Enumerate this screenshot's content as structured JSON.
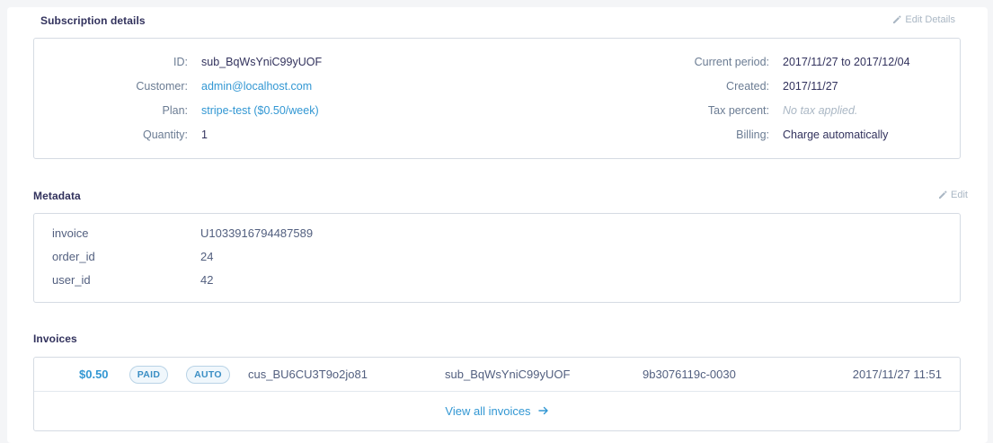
{
  "subscription": {
    "title": "Subscription details",
    "edit_label": "Edit Details",
    "left": [
      {
        "label": "ID:",
        "value": "sub_BqWsYniC99yUOF",
        "style": "plain"
      },
      {
        "label": "Customer:",
        "value": "admin@localhost.com",
        "style": "link"
      },
      {
        "label": "Plan:",
        "value": "stripe-test ($0.50/week)",
        "style": "link"
      },
      {
        "label": "Quantity:",
        "value": "1",
        "style": "plain"
      }
    ],
    "right": [
      {
        "label": "Current period:",
        "value": "2017/11/27 to 2017/12/04",
        "style": "plain"
      },
      {
        "label": "Created:",
        "value": "2017/11/27",
        "style": "plain"
      },
      {
        "label": "Tax percent:",
        "value": "No tax applied.",
        "style": "muted"
      },
      {
        "label": "Billing:",
        "value": "Charge automatically",
        "style": "plain"
      }
    ]
  },
  "metadata": {
    "title": "Metadata",
    "edit_label": "Edit",
    "rows": [
      {
        "key": "invoice",
        "value": "U1033916794487589"
      },
      {
        "key": "order_id",
        "value": "24"
      },
      {
        "key": "user_id",
        "value": "42"
      }
    ]
  },
  "invoices": {
    "title": "Invoices",
    "rows": [
      {
        "amount": "$0.50",
        "status": "PAID",
        "billing": "AUTO",
        "customer": "cus_BU6CU3T9o2jo81",
        "subscription": "sub_BqWsYniC99yUOF",
        "number": "9b3076119c-0030",
        "date": "2017/11/27 11:51"
      }
    ],
    "view_all_label": "View all invoices"
  },
  "icons": {
    "edit": "pencil-icon",
    "view_all": "arrow-right-icon"
  },
  "colors": {
    "accent": "#3297d3",
    "label": "#6b7c93",
    "text": "#32325d",
    "border": "#d5dbe3"
  }
}
